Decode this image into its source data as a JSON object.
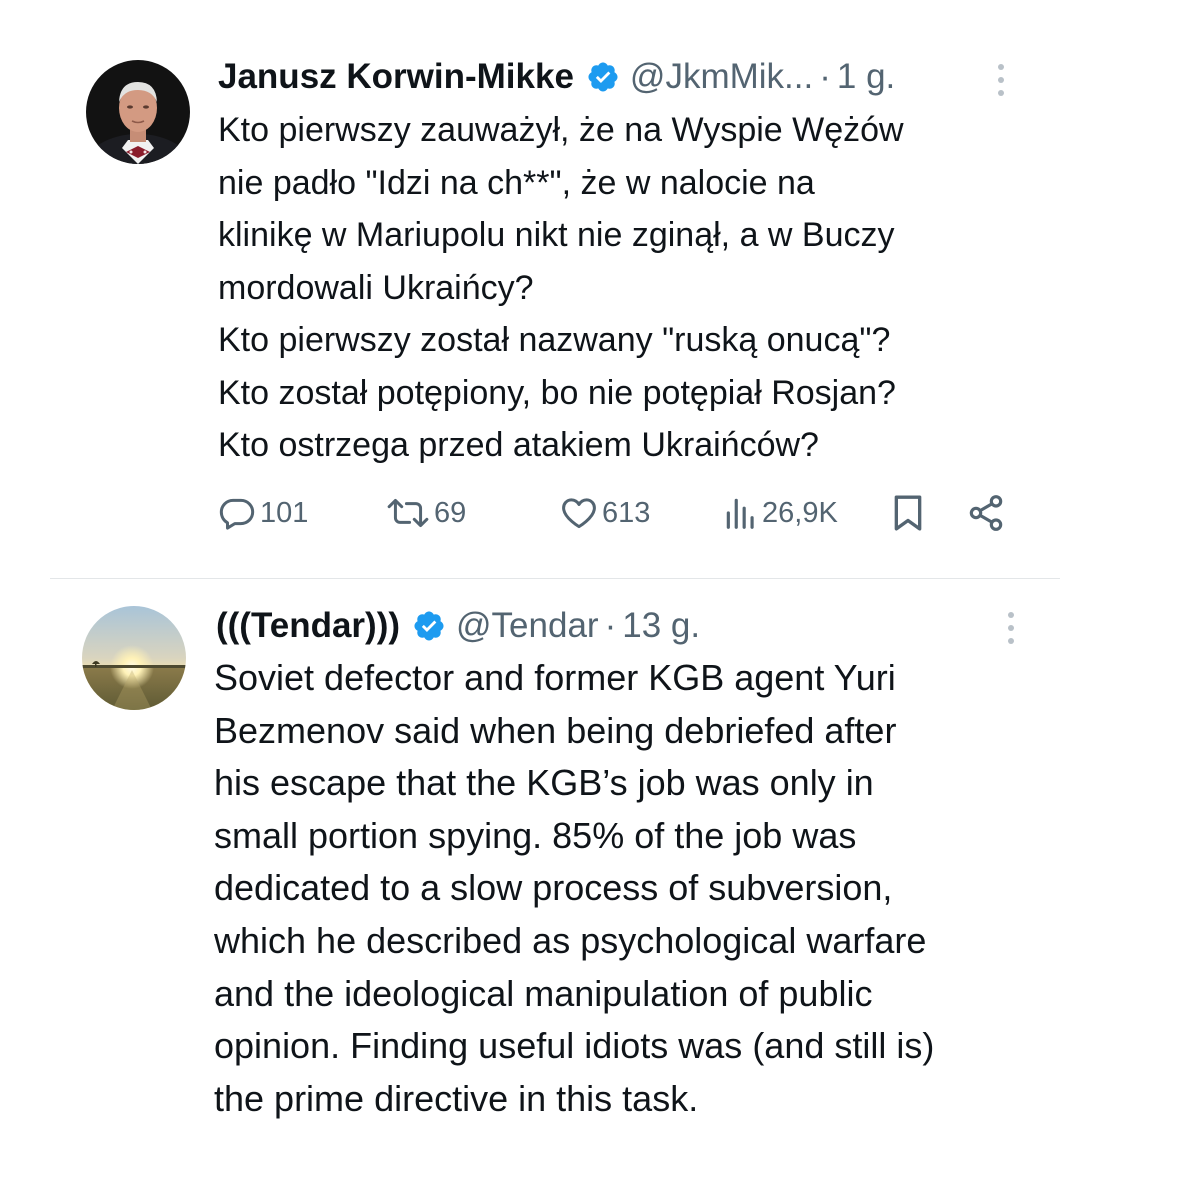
{
  "tweets": [
    {
      "author": {
        "name": "Janusz Korwin-Mikke",
        "handle": "@JkmMik...",
        "separator": "·",
        "time": "1 g."
      },
      "lines": [
        "Kto pierwszy zauważył, że na Wyspie Wężów",
        "nie padło \"Idzi na ch**\", że w nalocie na",
        "klinikę w Mariupolu nikt nie zginął, a w Buczy",
        "mordowali Ukraińcy?",
        "Kto pierwszy został nazwany \"ruską onucą\"?",
        "Kto został potępiony, bo nie potępiał Rosjan?",
        "Kto ostrzega przed atakiem Ukraińców?"
      ],
      "metrics": {
        "replies": "101",
        "reposts": "69",
        "likes": "613",
        "views": "26,9K"
      },
      "icons": [
        "verified-badge-icon",
        "more-options-icon",
        "reply-icon",
        "repost-icon",
        "like-icon",
        "views-icon",
        "bookmark-icon",
        "share-icon"
      ]
    },
    {
      "author": {
        "name": "(((Tendar)))",
        "handle": "@Tendar",
        "separator": "·",
        "time": "13 g."
      },
      "lines": [
        "Soviet defector and former KGB agent Yuri",
        "Bezmenov said when being debriefed after",
        "his escape that the KGB’s job was only in",
        "small portion spying. 85% of the job was",
        "dedicated to a slow process of subversion,",
        "which he described as psychological warfare",
        "and the ideological manipulation of public",
        "opinion. Finding useful idiots was (and still is)",
        "the prime directive in this task."
      ],
      "icons": [
        "verified-badge-icon",
        "more-options-icon"
      ]
    }
  ],
  "colors": {
    "text": "#0f1419",
    "secondary": "#536471",
    "verified": "#1d9bf0",
    "divider": "#e3e6e8",
    "background": "#ffffff"
  }
}
